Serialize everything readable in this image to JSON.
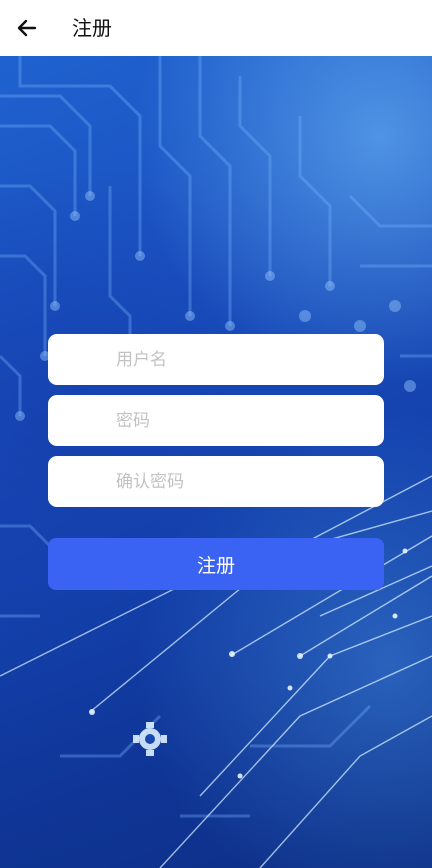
{
  "app_bar": {
    "back_icon": "arrow-left-icon",
    "title": "注册"
  },
  "form": {
    "username_placeholder": "用户名",
    "password_placeholder": "密码",
    "confirm_password_placeholder": "确认密码",
    "submit_label": "注册"
  },
  "colors": {
    "app_bar_bg": "#ffffff",
    "title_text": "#111111",
    "primary_button": "#3a63f4",
    "background_blue": "#1442ae",
    "placeholder_text": "#c2c2c2"
  }
}
